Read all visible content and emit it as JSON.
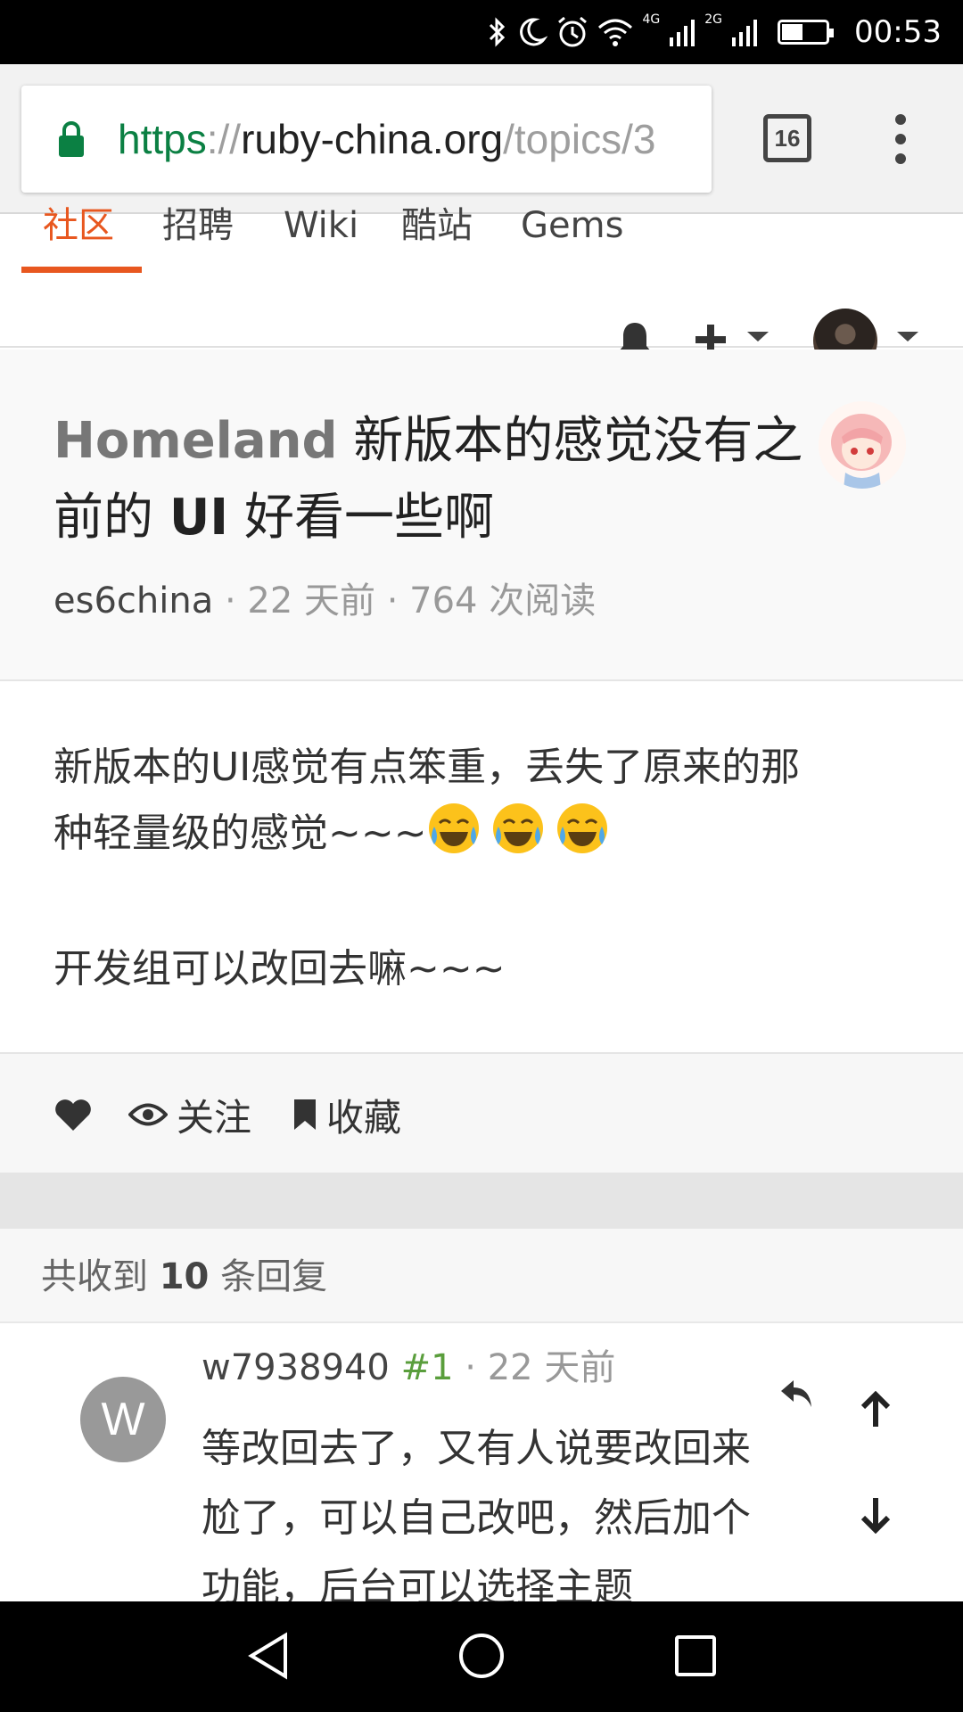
{
  "status_bar": {
    "time": "00:53",
    "network_1": "4G",
    "network_2": "2G",
    "icons": [
      "bluetooth-icon",
      "moon-icon",
      "alarm-icon",
      "wifi-icon",
      "signal-icon",
      "signal-icon",
      "battery-icon"
    ],
    "battery_level": 0.45
  },
  "browser": {
    "url_scheme": "https",
    "url_separator": "://",
    "url_host": "ruby-china.org",
    "url_path": "/topics/3",
    "tab_count": "16",
    "secure_color": "#0b8043"
  },
  "site_nav": {
    "items": [
      "社区",
      "招聘",
      "Wiki",
      "酷站",
      "Gems"
    ],
    "active_index": 0,
    "accent_color": "#e8571f"
  },
  "topic": {
    "node": "Homeland",
    "title_part1": "新版本的感觉没有之",
    "title_part2": "前的",
    "title_ui": "UI",
    "title_part3": "好看一些啊",
    "author": "es6china",
    "sep1": "·",
    "time": "22 天前",
    "sep2": "·",
    "reads": "764 次阅读",
    "body_line1": "新版本的UI感觉有点笨重，丢失了原来的那",
    "body_line2": "种轻量级的感觉~~~",
    "body_emojis": [
      "joy-emoji",
      "joy-emoji",
      "joy-emoji"
    ],
    "body_line3": "开发组可以改回去嘛~~~"
  },
  "actions": {
    "like_icon": "heart-icon",
    "follow_label": "关注",
    "favorite_label": "收藏"
  },
  "replies": {
    "prefix": "共收到",
    "count": "10",
    "suffix": "条回复",
    "items": [
      {
        "avatar_letter": "W",
        "user": "w7938940",
        "floor": "#1",
        "sep": "·",
        "time": "22 天前",
        "line1": "等改回去了，又有人说要改回来",
        "line2": "尬了，可以自己改吧，然后加个",
        "line3": "功能，后台可以选择主题"
      }
    ]
  }
}
